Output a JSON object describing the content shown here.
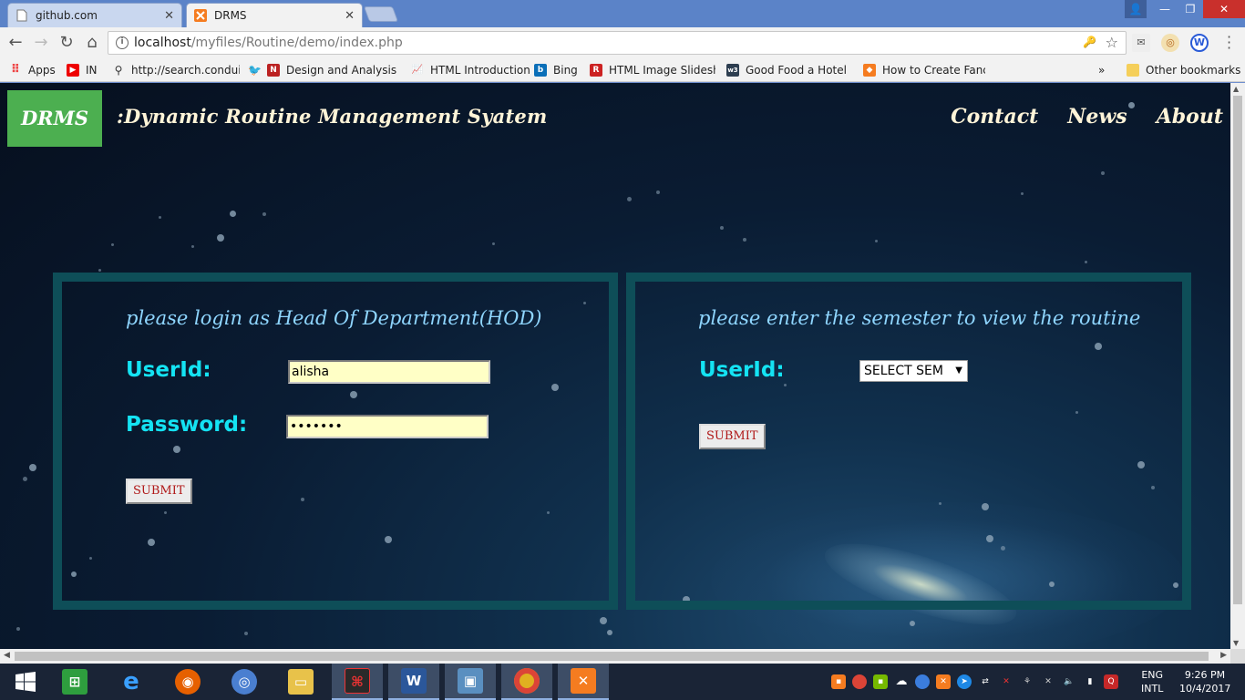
{
  "browser": {
    "tabs": [
      {
        "title": "github.com",
        "active": false
      },
      {
        "title": "DRMS",
        "active": true
      }
    ],
    "url_host": "localhost",
    "url_path": "/myfiles/Routine/demo/index.php",
    "bookmarks": [
      {
        "label": "Apps",
        "icon": "apps-grid-icon"
      },
      {
        "label": "IN",
        "icon": "youtube-icon"
      },
      {
        "label": "http://search.conduit",
        "icon": "search-icon"
      },
      {
        "label": "Design and Analysis c",
        "icon": "bookmark-icon"
      },
      {
        "label": "HTML Introduction",
        "icon": "bookmark-icon"
      },
      {
        "label": "Bing",
        "icon": "bing-icon"
      },
      {
        "label": "HTML Image Slidesho",
        "icon": "bookmark-icon"
      },
      {
        "label": "Good Food a Hotel C",
        "icon": "w3-icon"
      },
      {
        "label": "How to Create Fancy",
        "icon": "bookmark-icon"
      }
    ],
    "more_bookmarks": "»",
    "other_bookmarks": "Other bookmarks"
  },
  "site": {
    "brand": "DRMS",
    "title": ":Dynamic Routine Management Syatem",
    "nav": [
      "Contact",
      "News",
      "About"
    ]
  },
  "login_panel": {
    "heading": "please login as Head Of Department(HOD)",
    "userid_label": "UserId:",
    "userid_value": "alisha",
    "password_label": "Password:",
    "password_value": "alisha1",
    "submit_label": "SUBMIT"
  },
  "semester_panel": {
    "heading": "please enter the semester to view the routine",
    "userid_label": "UserId:",
    "select_value": "SELECT SEM",
    "submit_label": "SUBMIT"
  },
  "taskbar": {
    "language_top": "ENG",
    "language_bottom": "INTL",
    "time": "9:26 PM",
    "date": "10/4/2017"
  },
  "colors": {
    "brand_green": "#4caf50",
    "label_cyan": "#14e3f3",
    "heading_blue": "#8fd6ff",
    "panel_border": "#0e4e58",
    "input_bg": "#ffffc6",
    "submit_text": "#b01818"
  }
}
